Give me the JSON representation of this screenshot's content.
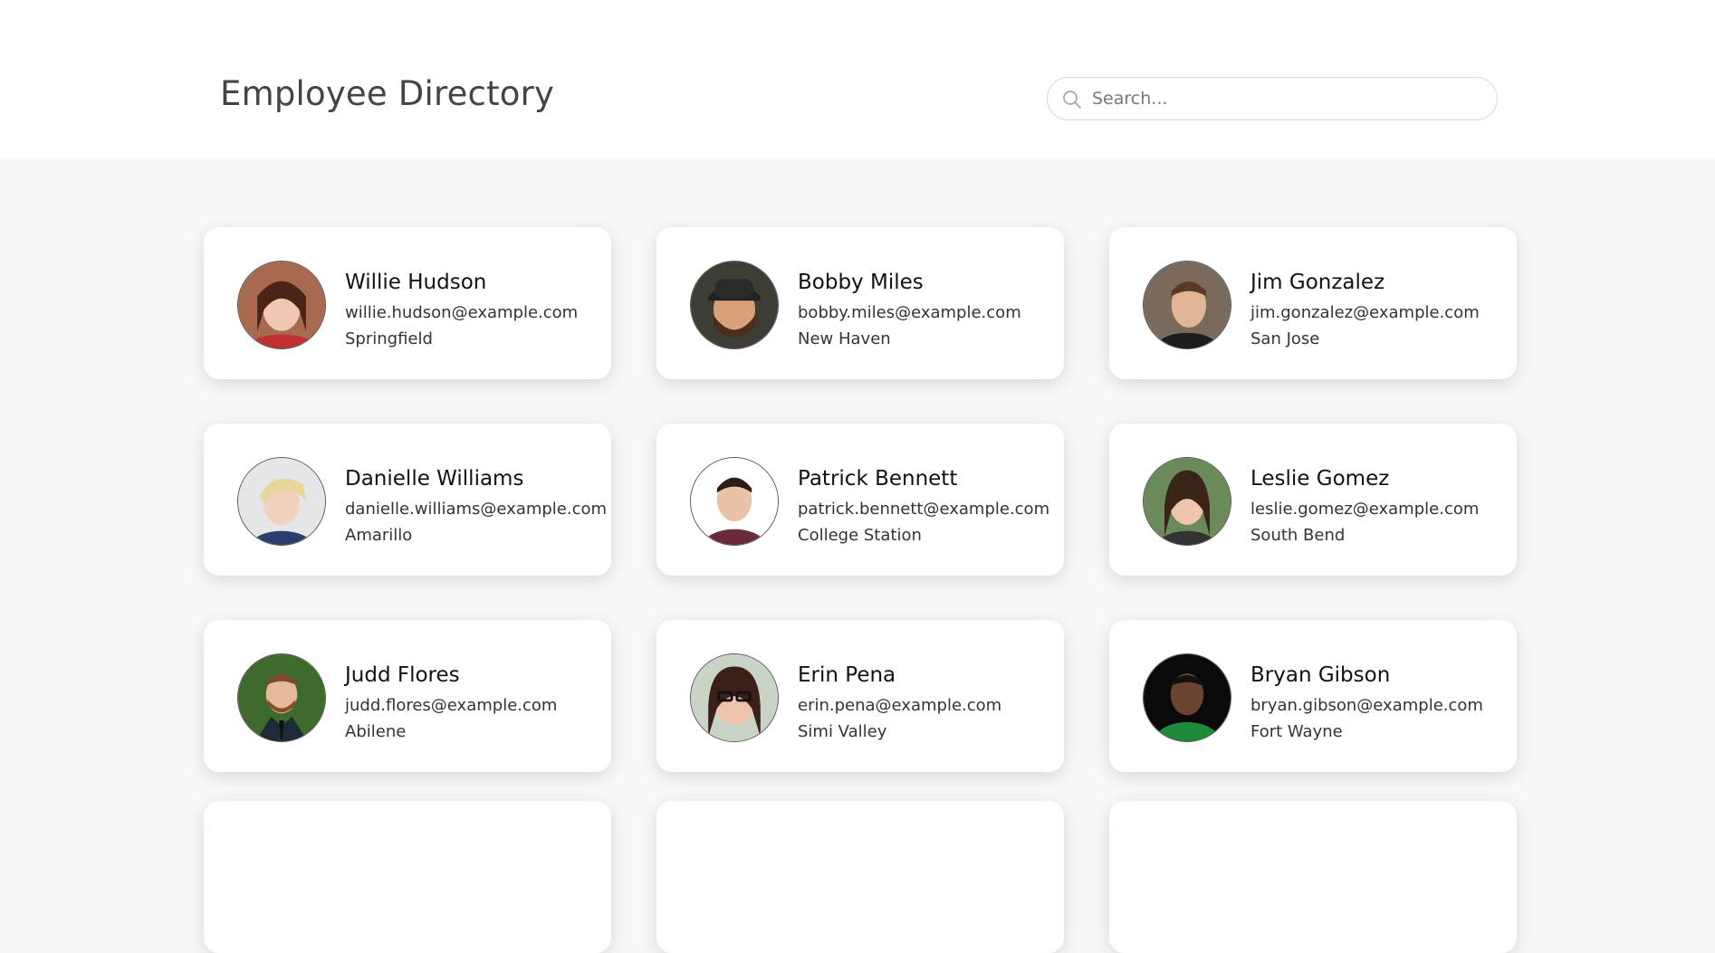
{
  "header": {
    "title": "Employee Directory",
    "search": {
      "placeholder": "Search...",
      "value": "",
      "icon": "search-icon"
    }
  },
  "employees": [
    {
      "name": "Willie Hudson",
      "email": "willie.hudson@example.com",
      "city": "Springfield"
    },
    {
      "name": "Bobby Miles",
      "email": "bobby.miles@example.com",
      "city": "New Haven"
    },
    {
      "name": "Jim Gonzalez",
      "email": "jim.gonzalez@example.com",
      "city": "San Jose"
    },
    {
      "name": "Danielle Williams",
      "email": "danielle.williams@example.com",
      "city": "Amarillo"
    },
    {
      "name": "Patrick Bennett",
      "email": "patrick.bennett@example.com",
      "city": "College Station"
    },
    {
      "name": "Leslie Gomez",
      "email": "leslie.gomez@example.com",
      "city": "South Bend"
    },
    {
      "name": "Judd Flores",
      "email": "judd.flores@example.com",
      "city": "Abilene"
    },
    {
      "name": "Erin Pena",
      "email": "erin.pena@example.com",
      "city": "Simi Valley"
    },
    {
      "name": "Bryan Gibson",
      "email": "bryan.gibson@example.com",
      "city": "Fort Wayne"
    }
  ],
  "colors": {
    "page_background": "#f7f8f9",
    "header_background": "#ffffff",
    "card_background": "#ffffff",
    "title_text": "#444444"
  }
}
